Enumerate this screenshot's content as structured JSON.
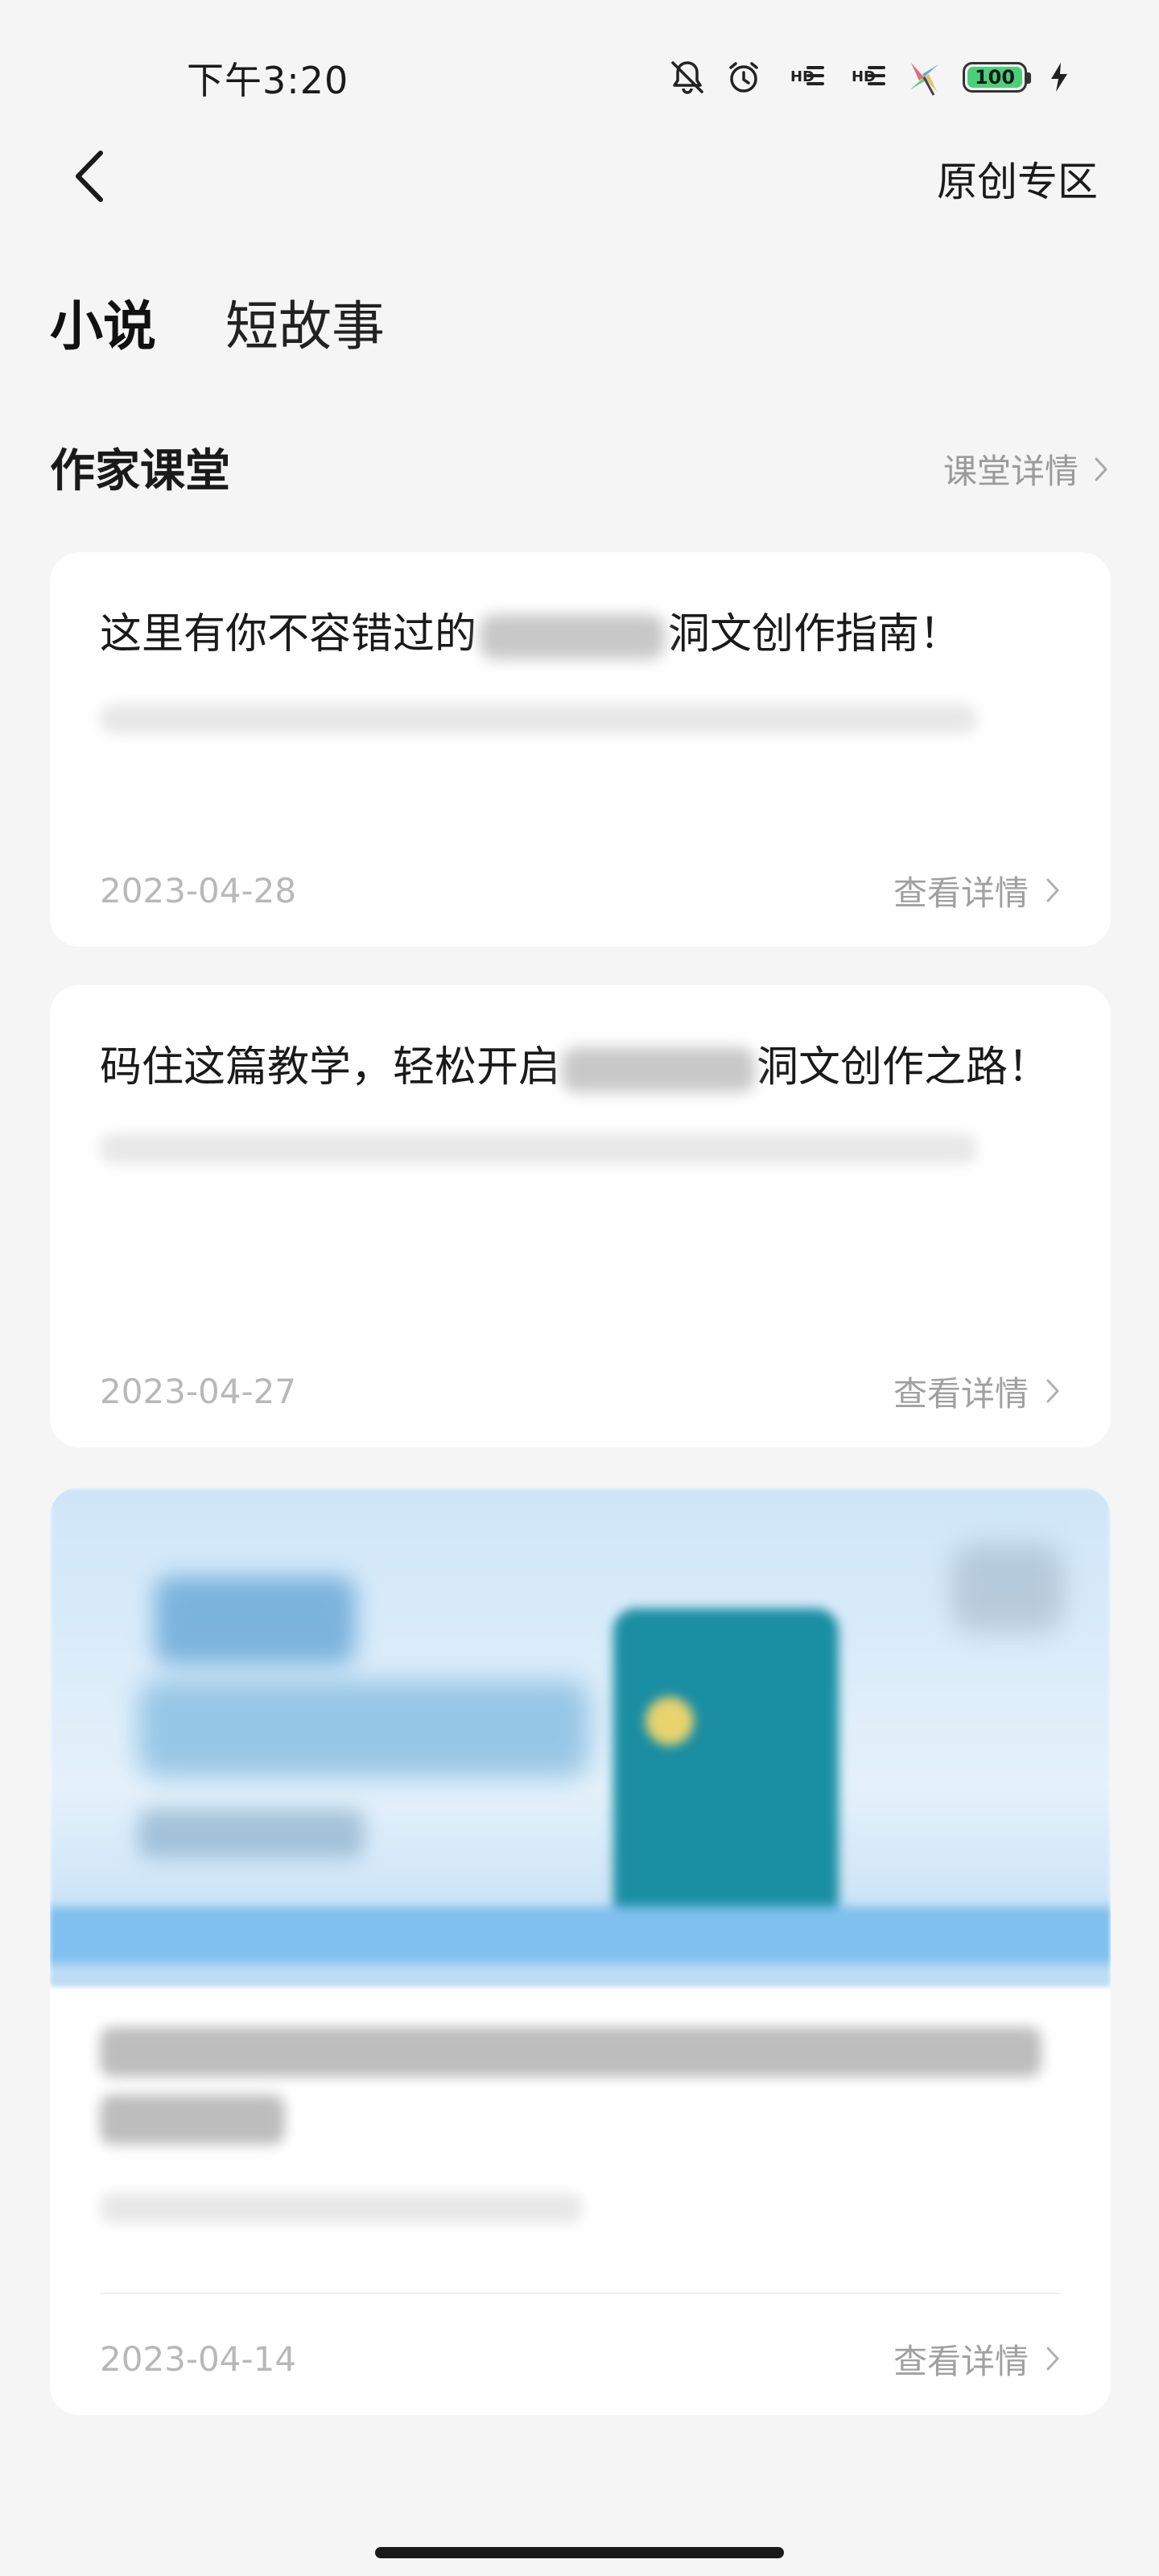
{
  "status_bar": {
    "time": "下午3:20",
    "icons": [
      "bell-off-icon",
      "alarm-icon",
      "hd-signal-icon",
      "hd-signal-icon",
      "app-notification-icon",
      "battery-icon",
      "charging-icon"
    ],
    "hd_label": "HD",
    "battery_level": "100",
    "battery_color": "#4bd07a"
  },
  "nav": {
    "back_icon": "chevron-left-icon",
    "title": "原创专区"
  },
  "tabs": [
    {
      "label": "小说",
      "active": true
    },
    {
      "label": "短故事",
      "active": false
    }
  ],
  "section": {
    "title": "作家课堂",
    "link_label": "课堂详情"
  },
  "cards": [
    {
      "title_prefix": "这里有你不容错过的",
      "title_suffix": "洞文创作指南！",
      "date": "2023-04-28",
      "more_label": "查看详情"
    },
    {
      "title_prefix": "码住这篇教学，轻松开启",
      "title_suffix": "洞文创作之路！",
      "date": "2023-04-27",
      "more_label": "查看详情"
    },
    {
      "date": "2023-04-14",
      "more_label": "查看详情"
    }
  ]
}
